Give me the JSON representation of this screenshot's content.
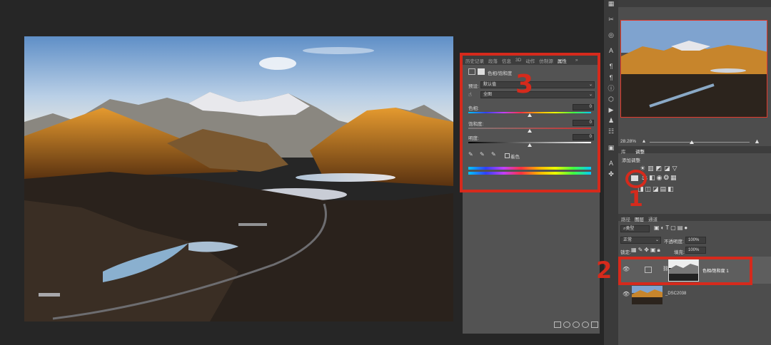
{
  "annotations": {
    "marker_1": "1",
    "marker_2": "2",
    "marker_3": "3"
  },
  "properties_panel": {
    "tabs": [
      "历史记录",
      "段落",
      "信息",
      "3D",
      "动作",
      "仿制源",
      "属性"
    ],
    "active_tab": "属性",
    "menu_glyph": "»",
    "title": "色相/饱和度",
    "preset_label": "预设:",
    "preset_value": "默认值",
    "channel_value": "全图",
    "hue_label": "色相:",
    "hue_value": "0",
    "saturation_label": "饱和度:",
    "saturation_value": "0",
    "lightness_label": "明度:",
    "lightness_value": "0",
    "colorize_label": "着色"
  },
  "navigator": {
    "zoom": "28.28%"
  },
  "adjustments_panel": {
    "tabs": [
      "库",
      "调整"
    ],
    "active_tab": "调整",
    "heading": "添加调整"
  },
  "layers_panel": {
    "tabs": [
      "路径",
      "图层",
      "通道"
    ],
    "active_tab": "图层",
    "filter_value": "类型",
    "blend_mode": "正常",
    "opacity_label": "不透明度:",
    "opacity_value": "100%",
    "lock_label": "锁定:",
    "fill_label": "填充:",
    "fill_value": "100%",
    "layers": [
      {
        "name": "色相/饱和度 1"
      },
      {
        "name": "_DSC2038"
      }
    ]
  },
  "colors": {
    "annotation_red": "#d62a1c",
    "panel_bg": "#535353",
    "app_bg": "#262626"
  }
}
